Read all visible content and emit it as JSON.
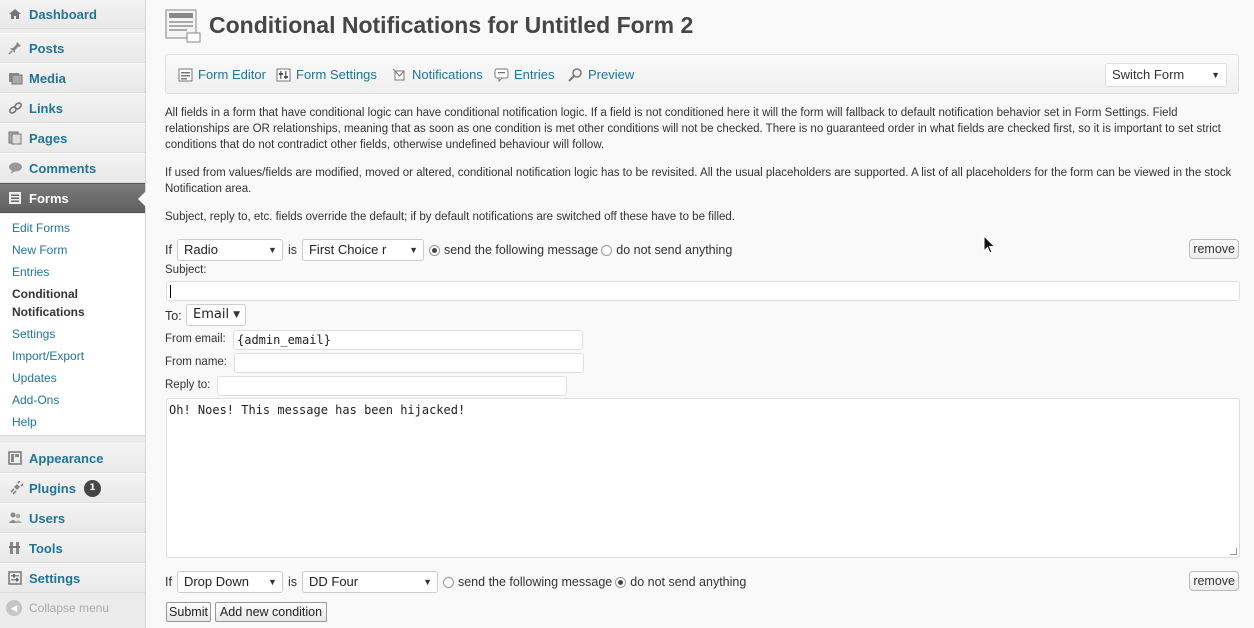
{
  "sidebar": {
    "items": [
      {
        "label": "Dashboard",
        "icon": "dashboard-icon"
      },
      {
        "label": "Posts",
        "icon": "pin-icon"
      },
      {
        "label": "Media",
        "icon": "media-icon"
      },
      {
        "label": "Links",
        "icon": "link-icon"
      },
      {
        "label": "Pages",
        "icon": "pages-icon"
      },
      {
        "label": "Comments",
        "icon": "comment-icon"
      },
      {
        "label": "Forms",
        "icon": "forms-icon"
      },
      {
        "label": "Appearance",
        "icon": "appearance-icon"
      },
      {
        "label": "Plugins",
        "icon": "plugin-icon",
        "badge": "1"
      },
      {
        "label": "Users",
        "icon": "users-icon"
      },
      {
        "label": "Tools",
        "icon": "tools-icon"
      },
      {
        "label": "Settings",
        "icon": "settings-icon"
      }
    ],
    "submenu": [
      "Edit Forms",
      "New Form",
      "Entries",
      "Conditional Notifications",
      "Settings",
      "Import/Export",
      "Updates",
      "Add-Ons",
      "Help"
    ],
    "submenu_current_line1": "Conditional",
    "submenu_current_line2": "Notifications",
    "collapse_label": "Collapse menu"
  },
  "page": {
    "title": "Conditional Notifications for Untitled Form 2"
  },
  "toolbar": {
    "links": [
      "Form Editor",
      "Form Settings",
      "Notifications",
      "Entries",
      "Preview"
    ],
    "switch_form": "Switch Form"
  },
  "description": {
    "p1": "All fields in a form that have conditional logic can have conditional notification logic. If a field is not conditioned here it will the form will fallback to default notification behavior set in Form Settings. Field relationships are OR relationships, meaning that as soon as one condition is met other conditions will not be checked. There is no guaranteed order in what fields are checked first, so it is important to set strict conditions that do not contradict other fields, otherwise undefined behaviour will follow.",
    "p2": "If used from values/fields are modified, moved or altered, conditional notification logic has to be revisited. All the usual placeholders are supported. A list of all placeholders for the form can be viewed in the stock Notification area.",
    "p3": "Subject, reply to, etc. fields override the default; if by default notifications are switched off these have to be filled."
  },
  "conditions": [
    {
      "if_label": "If",
      "field": "Radio",
      "is_label": "is",
      "value": "First Choice r",
      "send_label": "send the following message",
      "nosend_label": "do not send anything",
      "send_selected": true,
      "remove_label": "remove"
    },
    {
      "if_label": "If",
      "field": "Drop Down",
      "is_label": "is",
      "value": "DD Four",
      "send_label": "send the following message",
      "nosend_label": "do not send anything",
      "send_selected": false,
      "remove_label": "remove"
    }
  ],
  "message_form": {
    "subject_label": "Subject:",
    "subject_value": "",
    "to_label": "To:",
    "to_value": "Email",
    "from_email_label": "From email:",
    "from_email_value": "{admin_email}",
    "from_name_label": "From name:",
    "from_name_value": "",
    "reply_to_label": "Reply to:",
    "reply_to_value": "",
    "message": "Oh! Noes! This message has been hijacked!"
  },
  "actions": {
    "submit": "Submit",
    "add_condition": "Add new condition"
  },
  "colors": {
    "link": "#21759b",
    "sidebar_bg": "#ececec",
    "current_menu": "#6d6d6d",
    "page_bg": "#f9f9f9"
  }
}
